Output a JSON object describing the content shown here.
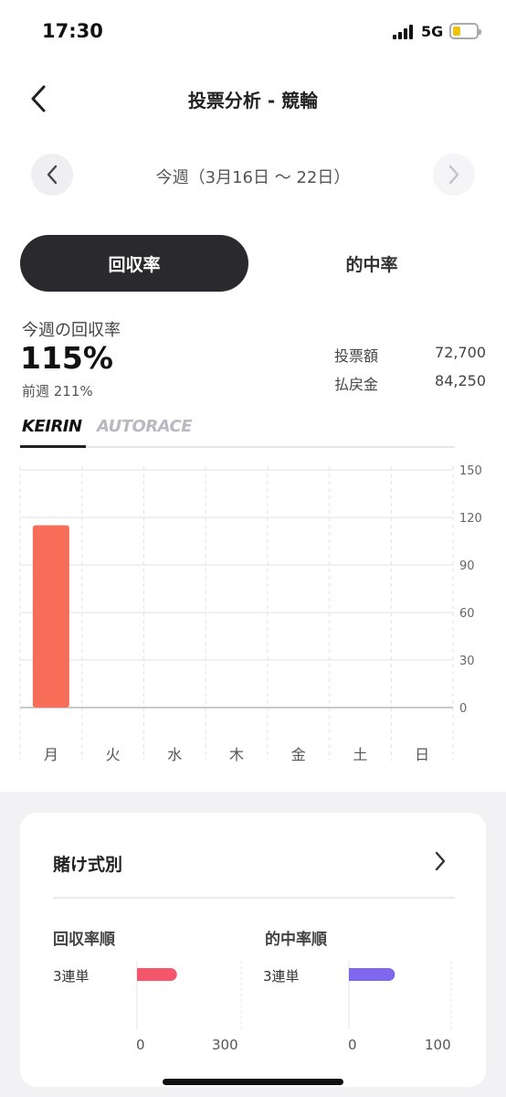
{
  "status": {
    "time": "17:30",
    "network": "5G",
    "battery_level": 0.3
  },
  "header": {
    "title": "投票分析 - 競輪"
  },
  "week": {
    "label": "今週（3月16日 〜 22日）"
  },
  "tabs": [
    {
      "label": "回収率",
      "active": true
    },
    {
      "label": "的中率",
      "active": false
    }
  ],
  "summary": {
    "label": "今週の回収率",
    "rate": "115%",
    "previous": "前週 211%",
    "bet_label": "投票額",
    "bet_value": "72,700",
    "payout_label": "払戻金",
    "payout_value": "84,250"
  },
  "brands": {
    "keirin": "KEIRIN",
    "autorace": "AUTORACE"
  },
  "chart_data": {
    "type": "bar",
    "categories": [
      "月",
      "火",
      "水",
      "木",
      "金",
      "土",
      "日"
    ],
    "values": [
      115,
      0,
      0,
      0,
      0,
      0,
      0
    ],
    "ylim": [
      0,
      150
    ],
    "yticks": [
      0,
      30,
      60,
      90,
      120,
      150
    ],
    "color": "#f86d58",
    "grid": true
  },
  "bet_types": {
    "title": "賭け式別",
    "recovery": {
      "title": "回収率順",
      "label": "3連単",
      "value": 115,
      "max": 300,
      "axis_min": "0",
      "axis_max": "300",
      "color": "#f4566c"
    },
    "hit": {
      "title": "的中率順",
      "label": "3連単",
      "value": 45,
      "max": 100,
      "axis_min": "0",
      "axis_max": "100",
      "color": "#7f67ee"
    }
  }
}
